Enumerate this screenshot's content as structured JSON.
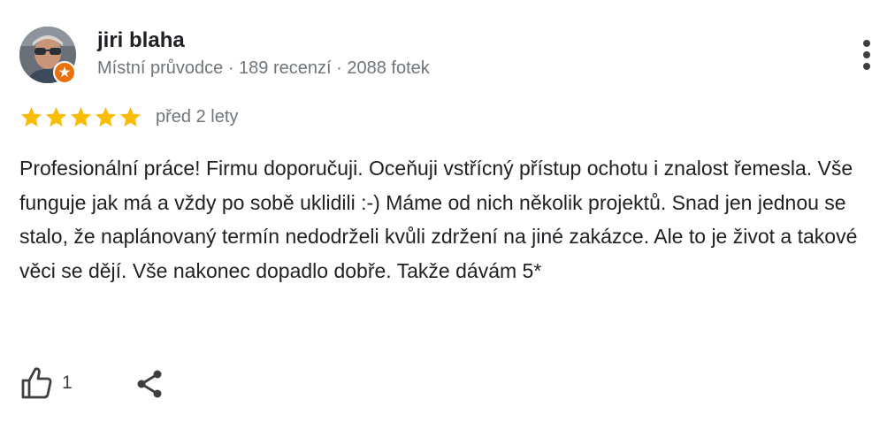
{
  "review": {
    "author": {
      "name": "jiri blaha",
      "meta": "Místní průvodce · 189 recenzí · 2088 fotek",
      "avatar_icon": "user-photo",
      "badge_icon": "local-guide-badge-icon",
      "badge_color": "#e8710a"
    },
    "rating": {
      "stars": 5,
      "max_stars": 5,
      "star_color": "#fbbc04",
      "time_ago": "před 2 lety"
    },
    "text": "Profesionální práce! Firmu doporučuji. Oceňuji vstřícný přístup ochotu i znalost řemesla. Vše funguje jak má a vždy po sobě uklidili :-) Máme od nich několik projektů. Snad jen jednou se stalo, že naplánovaný termín nedodrželi kvůli zdržení na jiné zakázce. Ale to je život a takové věci se dějí. Vše nakonec dopadlo dobře. Takže dávám 5*",
    "actions": {
      "like_icon": "thumb-up-icon",
      "like_count": "1",
      "share_icon": "share-icon",
      "more_icon": "more-vert-icon"
    }
  }
}
